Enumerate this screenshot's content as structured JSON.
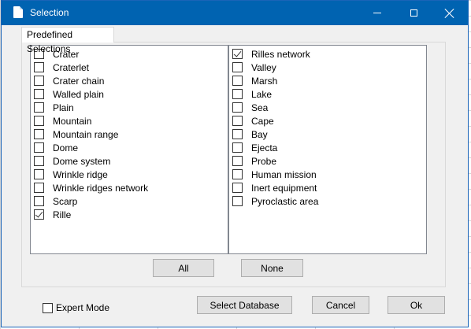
{
  "window": {
    "title": "Selection"
  },
  "tab": {
    "label": "Predefined Selections"
  },
  "left_list": [
    {
      "label": "Crater",
      "checked": false
    },
    {
      "label": "Craterlet",
      "checked": false
    },
    {
      "label": "Crater chain",
      "checked": false
    },
    {
      "label": "Walled plain",
      "checked": false
    },
    {
      "label": "Plain",
      "checked": false
    },
    {
      "label": "Mountain",
      "checked": false
    },
    {
      "label": "Mountain range",
      "checked": false
    },
    {
      "label": "Dome",
      "checked": false
    },
    {
      "label": "Dome system",
      "checked": false
    },
    {
      "label": "Wrinkle ridge",
      "checked": false
    },
    {
      "label": "Wrinkle ridges network",
      "checked": false
    },
    {
      "label": "Scarp",
      "checked": false
    },
    {
      "label": "Rille",
      "checked": true
    }
  ],
  "right_list": [
    {
      "label": "Rilles network",
      "checked": true
    },
    {
      "label": "Valley",
      "checked": false
    },
    {
      "label": "Marsh",
      "checked": false
    },
    {
      "label": "Lake",
      "checked": false
    },
    {
      "label": "Sea",
      "checked": false
    },
    {
      "label": "Cape",
      "checked": false
    },
    {
      "label": "Bay",
      "checked": false
    },
    {
      "label": "Ejecta",
      "checked": false
    },
    {
      "label": "Probe",
      "checked": false
    },
    {
      "label": "Human mission",
      "checked": false
    },
    {
      "label": "Inert equipment",
      "checked": false
    },
    {
      "label": "Pyroclastic area",
      "checked": false
    }
  ],
  "buttons": {
    "all": "All",
    "none": "None",
    "select_database": "Select Database",
    "cancel": "Cancel",
    "ok": "Ok"
  },
  "expert_mode": {
    "label": "Expert Mode",
    "checked": false
  }
}
